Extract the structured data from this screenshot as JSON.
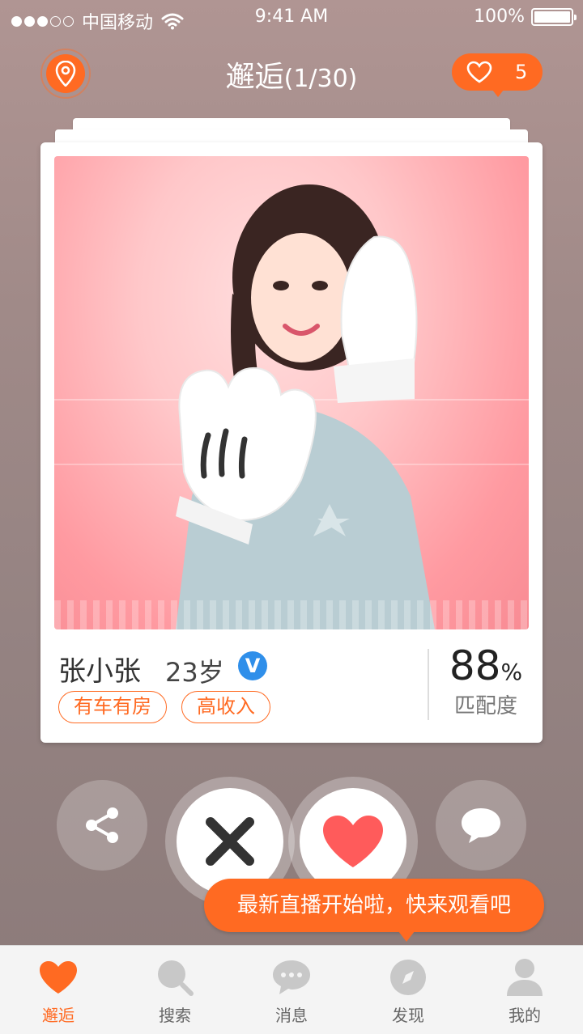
{
  "status_bar": {
    "carrier": "中国移动",
    "signal_strength": 3,
    "time": "9:41 AM",
    "battery": "100%"
  },
  "header": {
    "title": "邂逅",
    "count": "(1/30)",
    "likes": "5"
  },
  "profile": {
    "name": "张小张",
    "age": "23岁",
    "verified_badge": "V",
    "tags": [
      "有车有房",
      "高收入"
    ],
    "match_value": "88",
    "match_unit": "%",
    "match_label": "匹配度"
  },
  "toast": {
    "text": "最新直播开始啦，快来观看吧"
  },
  "tabbar": {
    "items": [
      {
        "label": "邂逅",
        "icon": "heart-icon",
        "active": true
      },
      {
        "label": "搜索",
        "icon": "search-icon",
        "active": false
      },
      {
        "label": "消息",
        "icon": "message-icon",
        "active": false
      },
      {
        "label": "发现",
        "icon": "compass-icon",
        "active": false
      },
      {
        "label": "我的",
        "icon": "user-icon",
        "active": false
      }
    ]
  },
  "colors": {
    "accent": "#ff6a22",
    "verified": "#2f8fea",
    "like_red": "#ff5b5b"
  }
}
